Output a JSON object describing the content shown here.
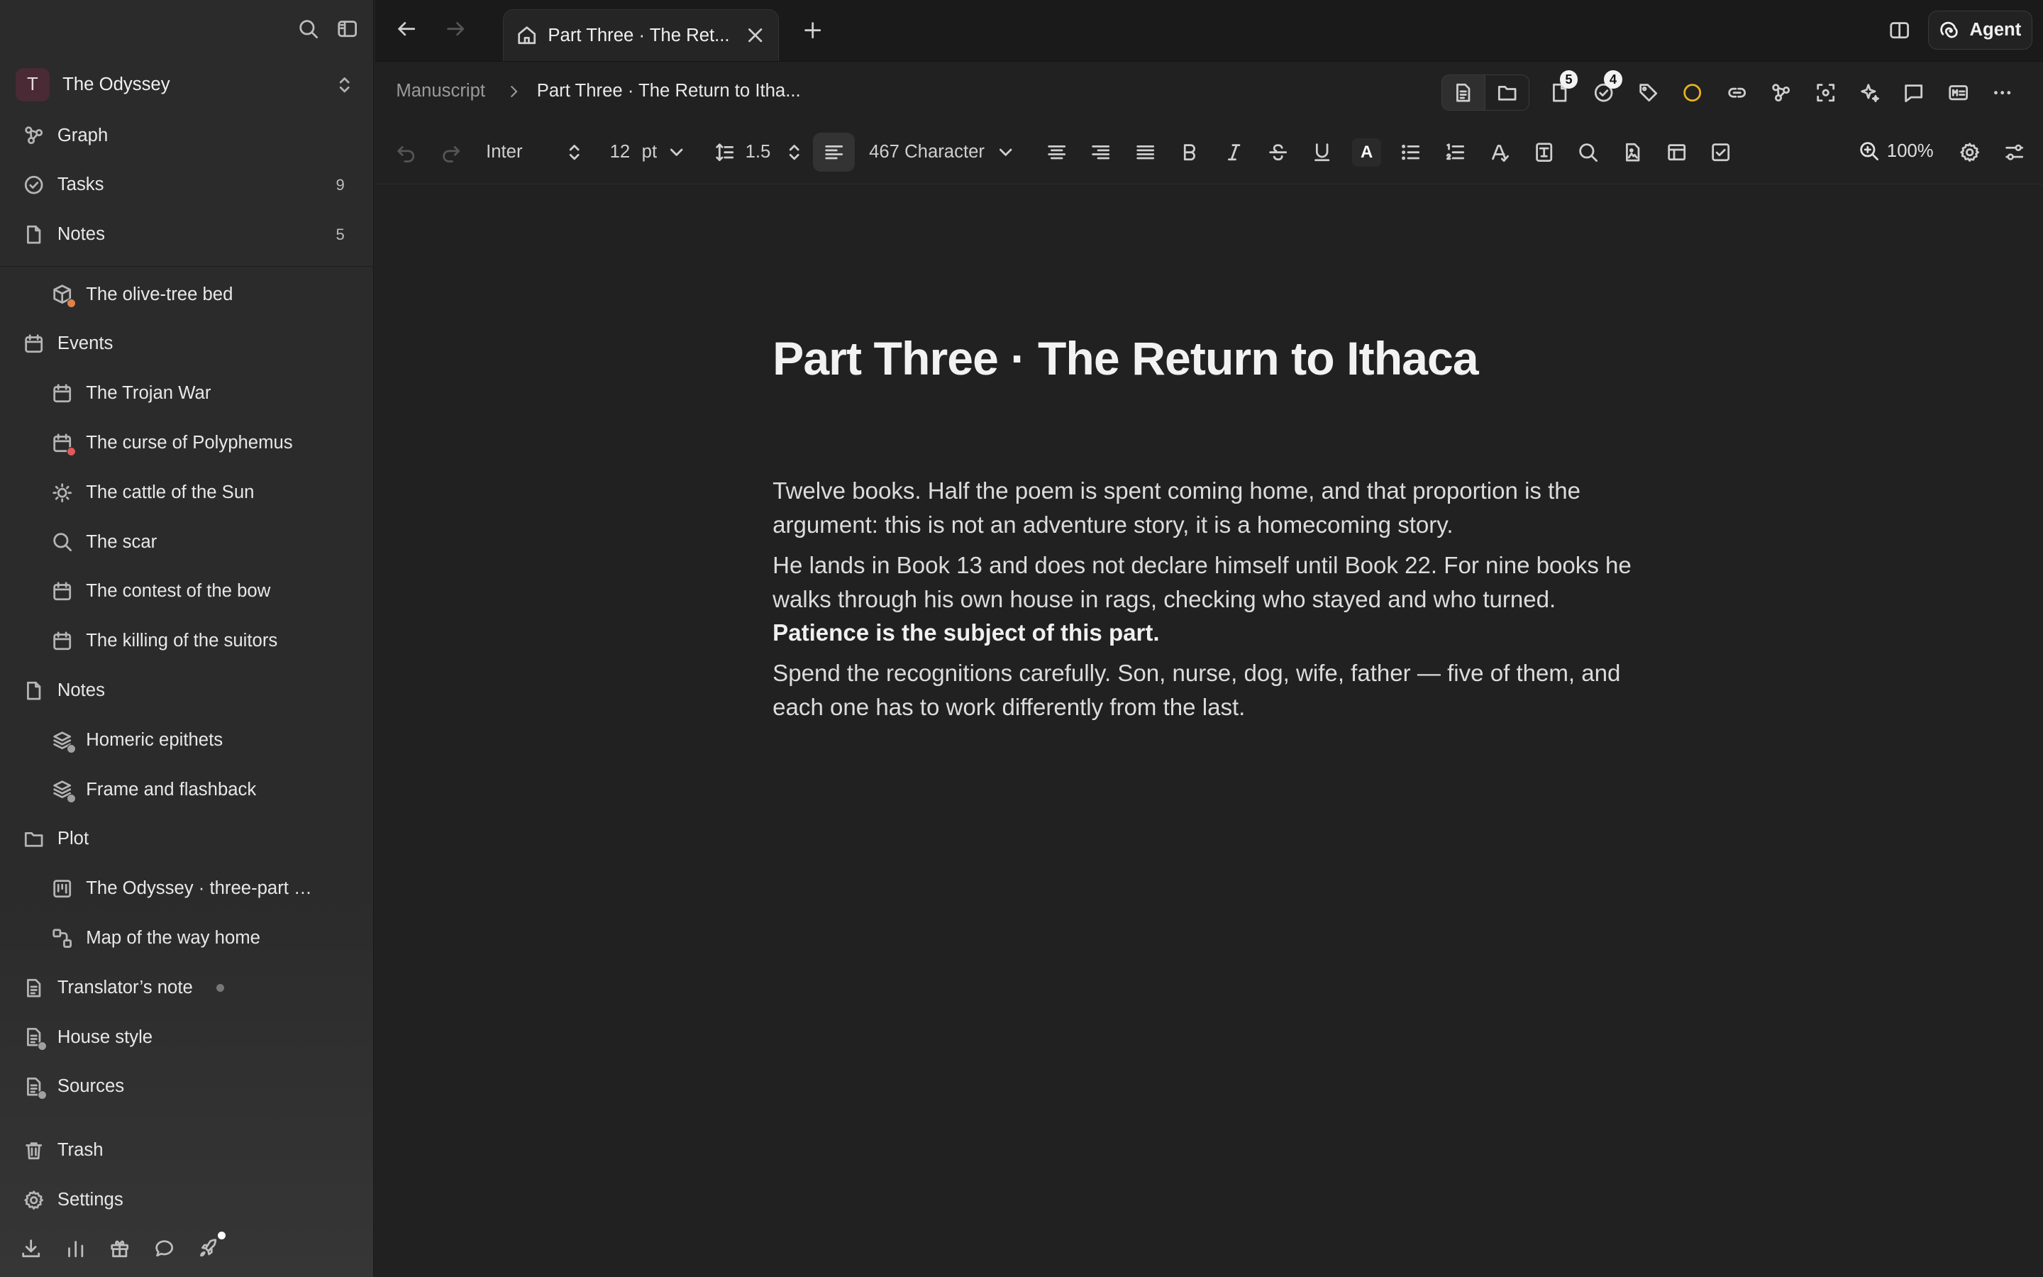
{
  "workspace": {
    "initial": "T",
    "name": "The Odyssey"
  },
  "sidebar": {
    "top": [
      {
        "label": "Graph",
        "icon": "graph-icon"
      },
      {
        "label": "Tasks",
        "count": "9",
        "icon": "tasks-icon"
      },
      {
        "label": "Notes",
        "count": "5",
        "icon": "notes-icon"
      }
    ],
    "items": [
      {
        "label": "The olive-tree bed",
        "level": 1,
        "icon": "cube-icon",
        "dot": "#e0824a"
      },
      {
        "label": "Events",
        "level": 0,
        "icon": "calendar-icon"
      },
      {
        "label": "The Trojan War",
        "level": 1,
        "icon": "calendar-icon"
      },
      {
        "label": "The curse of Polyphemus",
        "level": 1,
        "icon": "calendar-icon",
        "dot": "#e05a5a"
      },
      {
        "label": "The cattle of the Sun",
        "level": 1,
        "icon": "sun-icon"
      },
      {
        "label": "The scar",
        "level": 1,
        "icon": "search-icon"
      },
      {
        "label": "The contest of the bow",
        "level": 1,
        "icon": "calendar-icon"
      },
      {
        "label": "The killing of the suitors",
        "level": 1,
        "icon": "calendar-icon"
      },
      {
        "label": "Notes",
        "level": 0,
        "icon": "notes-icon"
      },
      {
        "label": "Homeric epithets",
        "level": 1,
        "icon": "layers-icon",
        "dot": "#a0a0a0"
      },
      {
        "label": "Frame and flashback",
        "level": 1,
        "icon": "layers-icon",
        "dot": "#a0a0a0"
      },
      {
        "label": "Plot",
        "level": 0,
        "icon": "folder-icon"
      },
      {
        "label": "The Odyssey · three-part …",
        "level": 1,
        "icon": "board-icon"
      },
      {
        "label": "Map of the way home",
        "level": 1,
        "icon": "map-icon"
      },
      {
        "label": "Translator’s note",
        "level": 0,
        "icon": "doc-icon",
        "dot": "#888888"
      },
      {
        "label": "House style",
        "level": 0,
        "icon": "doc-icon",
        "dot": "#a0a0a0"
      },
      {
        "label": "Sources",
        "level": 0,
        "icon": "doc-icon",
        "dot": "#a0a0a0"
      },
      {
        "label": "Trash",
        "level": 0,
        "icon": "trash-icon"
      },
      {
        "label": "Settings",
        "level": 0,
        "icon": "gear-icon"
      }
    ]
  },
  "tab": {
    "title": "Part Three · The Ret..."
  },
  "agent": {
    "label": "Agent"
  },
  "breadcrumb": {
    "root": "Manuscript",
    "current": "Part Three · The Return to Itha..."
  },
  "badges": {
    "notes": "5",
    "tasks": "4"
  },
  "toolbar": {
    "font": "Inter",
    "size": "12",
    "unit": "pt",
    "line_height": "1.5",
    "count": "467 Character",
    "zoom": "100%"
  },
  "document": {
    "title": "Part Three · The Return to Ithaca",
    "p1": "Twelve books. Half the poem is spent coming home, and that proportion is the argument: this is not an adventure story, it is a homecoming story.",
    "p2": "He lands in Book 13 and does not declare himself until Book 22. For nine books he walks through his own house in rags, checking who stayed and who turned.",
    "p2_bold": "Patience is the subject of this part.",
    "p3": "Spend the recognitions carefully. Son, nurse, dog, wife, father — five of them, and each one has to work differently from the last."
  },
  "colors": {
    "accent_circle": "#e8b21f",
    "avatar_bg": "#4a2a34"
  }
}
